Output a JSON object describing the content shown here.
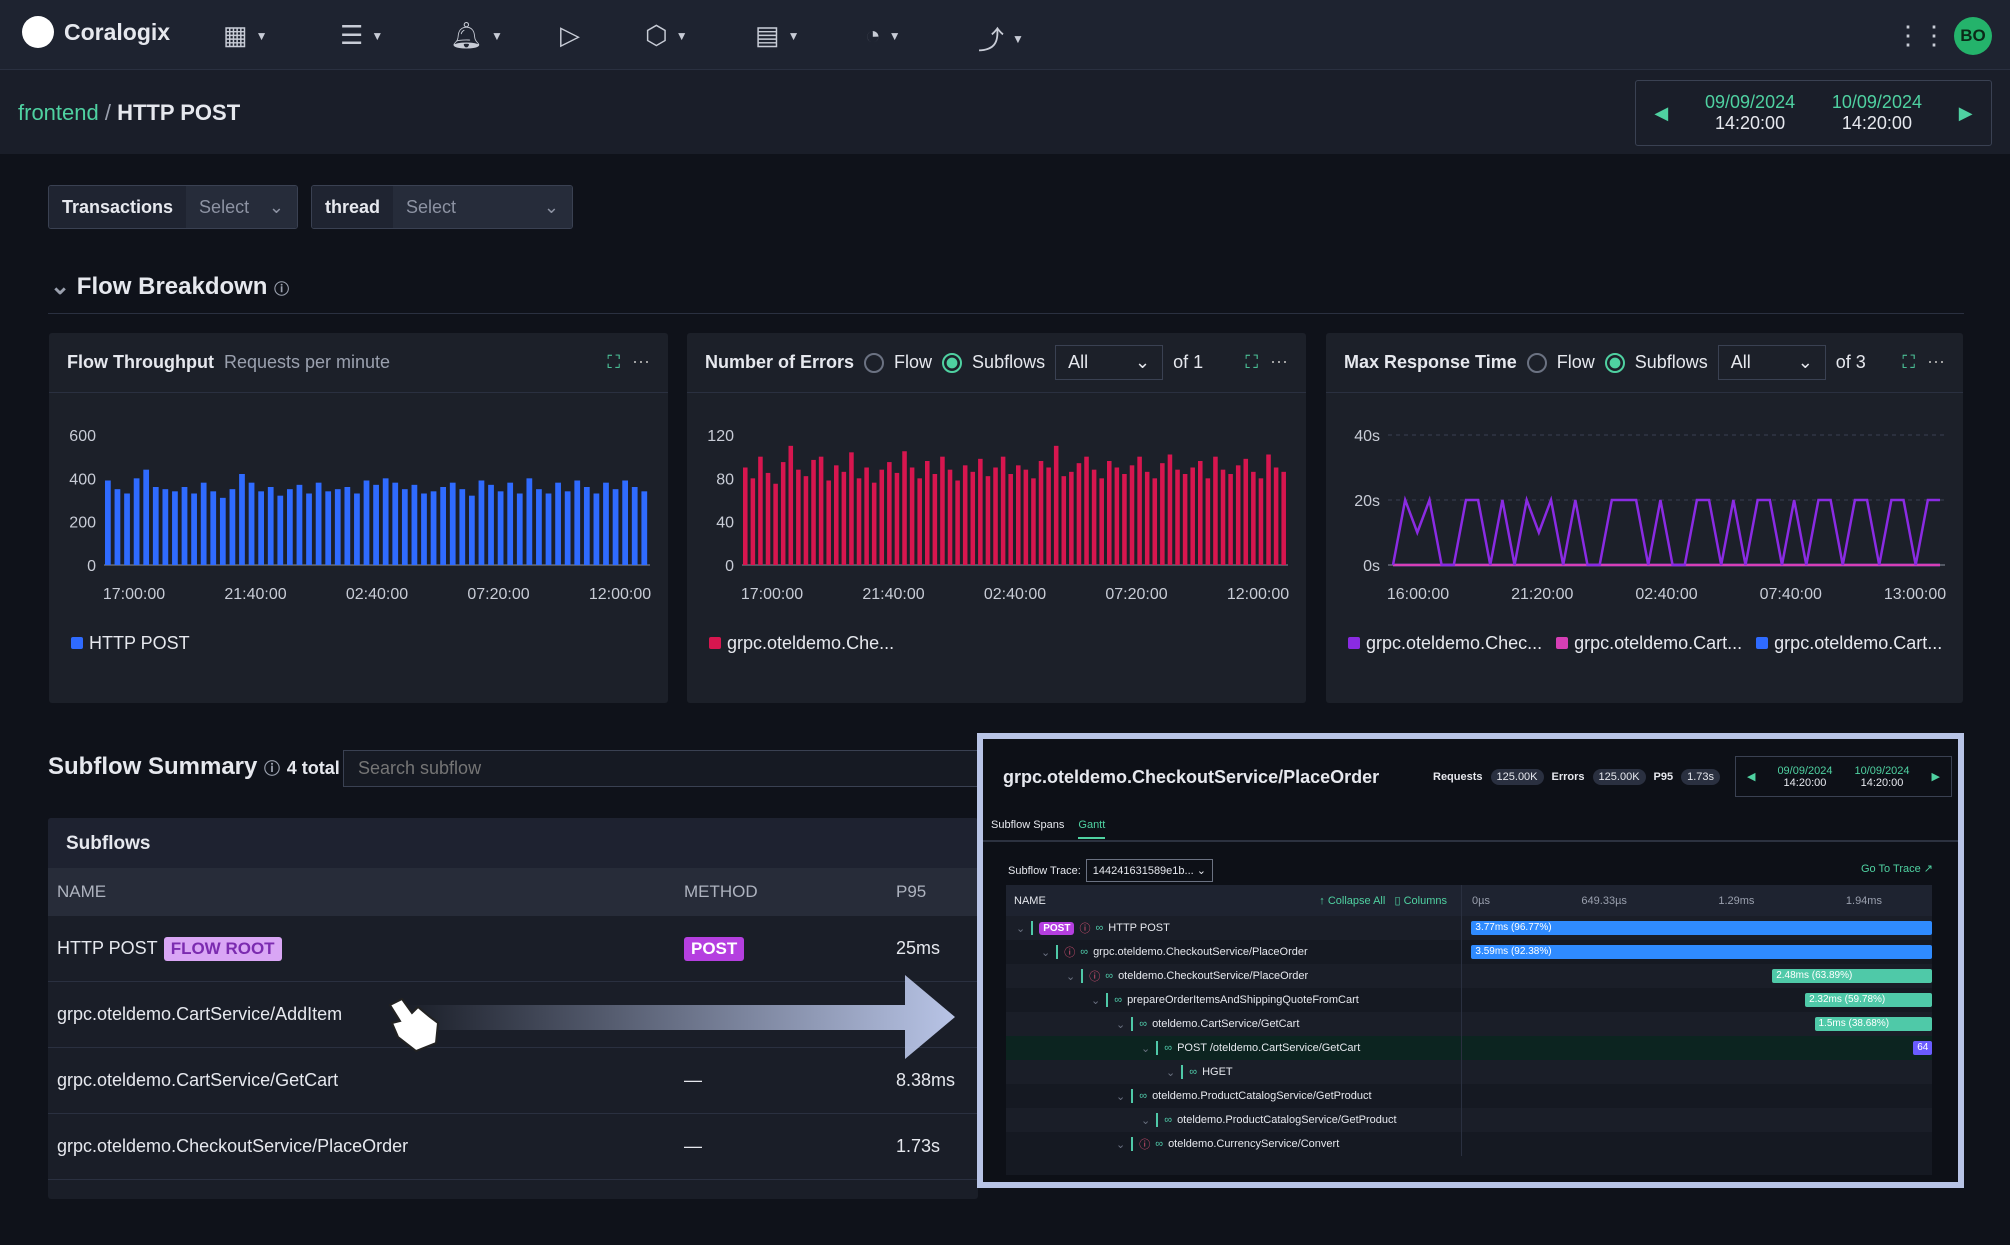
{
  "app": {
    "brand": "Coralogix",
    "user_initials": "BO",
    "nav_icons": [
      "dashboard-icon",
      "logs-icon",
      "bell-icon",
      "play-icon",
      "hexagon-icon",
      "server-icon",
      "gauge-icon",
      "flow-icon"
    ]
  },
  "breadcrumb": {
    "parent": "frontend",
    "current": "HTTP POST"
  },
  "daterange": {
    "from_date": "09/09/2024",
    "from_time": "14:20:00",
    "to_date": "10/09/2024",
    "to_time": "14:20:00"
  },
  "filters": [
    {
      "label": "Transactions",
      "value": "Select"
    },
    {
      "label": "thread",
      "value": "Select"
    }
  ],
  "flow_breakdown": {
    "title": "Flow Breakdown"
  },
  "panels": {
    "throughput": {
      "title": "Flow Throughput",
      "subtitle": "Requests per minute"
    },
    "errors": {
      "title": "Number of Errors",
      "radio_flow": "Flow",
      "radio_subflows": "Subflows",
      "select": "All",
      "of": "of 1"
    },
    "response": {
      "title": "Max Response Time",
      "radio_flow": "Flow",
      "radio_subflows": "Subflows",
      "select": "All",
      "of": "of 3"
    }
  },
  "chart_data": [
    {
      "type": "bar",
      "ylim": [
        0,
        600
      ],
      "yticks": [
        "600",
        "400",
        "200",
        "0"
      ],
      "xticks": [
        "17:00:00",
        "21:40:00",
        "02:40:00",
        "07:20:00",
        "12:00:00"
      ],
      "series": [
        {
          "name": "HTTP POST",
          "color": "#2f6bff",
          "values": [
            390,
            350,
            330,
            400,
            440,
            360,
            350,
            340,
            360,
            330,
            380,
            340,
            310,
            350,
            420,
            380,
            340,
            360,
            320,
            350,
            370,
            330,
            380,
            340,
            350,
            360,
            330,
            390,
            370,
            400,
            380,
            350,
            370,
            330,
            340,
            360,
            380,
            350,
            320,
            390,
            370,
            340,
            380,
            330,
            400,
            350,
            330,
            380,
            340,
            390,
            360,
            330,
            380,
            350,
            390,
            360,
            340
          ]
        }
      ]
    },
    {
      "type": "bar",
      "ylim": [
        0,
        120
      ],
      "yticks": [
        "120",
        "80",
        "40",
        "0"
      ],
      "xticks": [
        "17:00:00",
        "21:40:00",
        "02:40:00",
        "07:20:00",
        "12:00:00"
      ],
      "series": [
        {
          "name": "grpc.oteldemo.Che...",
          "color": "#d7164f",
          "values": [
            90,
            80,
            100,
            85,
            75,
            95,
            110,
            88,
            82,
            97,
            100,
            78,
            92,
            86,
            104,
            80,
            90,
            76,
            88,
            95,
            85,
            105,
            90,
            80,
            96,
            84,
            100,
            88,
            78,
            92,
            86,
            98,
            82,
            90,
            100,
            84,
            92,
            88,
            80,
            96,
            90,
            110,
            82,
            86,
            94,
            100,
            88,
            80,
            96,
            90,
            84,
            92,
            100,
            86,
            80,
            94,
            102,
            88,
            84,
            90,
            96,
            80,
            100,
            88,
            84,
            92,
            98,
            86,
            80,
            102,
            90,
            86
          ]
        }
      ]
    },
    {
      "type": "line",
      "ylim": [
        0,
        40
      ],
      "yticks": [
        "40s",
        "20s",
        "0s"
      ],
      "xticks": [
        "16:00:00",
        "21:20:00",
        "02:40:00",
        "07:40:00",
        "13:00:00"
      ],
      "series": [
        {
          "name": "grpc.oteldemo.Chec...",
          "color": "#8a2be2",
          "values": [
            0,
            20,
            10,
            20,
            0,
            0,
            20,
            20,
            0,
            20,
            0,
            20,
            10,
            20,
            0,
            20,
            0,
            0,
            20,
            20,
            20,
            0,
            20,
            0,
            0,
            20,
            20,
            0,
            20,
            0,
            20,
            20,
            0,
            20,
            0,
            20,
            20,
            0,
            20,
            20,
            0,
            20,
            20,
            0,
            20,
            20
          ]
        },
        {
          "name": "grpc.oteldemo.Cart...",
          "color": "#d63fb5",
          "values": [
            0,
            0,
            0,
            0,
            0,
            0,
            0,
            0,
            0,
            0,
            0,
            0,
            0,
            0,
            0,
            0,
            0,
            0,
            0,
            0,
            0,
            0,
            0,
            0,
            0,
            0,
            0,
            0,
            0,
            0,
            0,
            0,
            0,
            0,
            0,
            0,
            0,
            0,
            0,
            0,
            0,
            0,
            0,
            0,
            0,
            0
          ]
        },
        {
          "name": "grpc.oteldemo.Cart...",
          "color": "#2f6bff",
          "values": [
            0,
            0,
            0,
            0,
            0,
            0,
            0,
            0,
            0,
            0,
            0,
            0,
            0,
            0,
            0,
            0,
            0,
            0,
            0,
            0,
            0,
            0,
            0,
            0,
            0,
            0,
            0,
            0,
            0,
            0,
            0,
            0,
            0,
            0,
            0,
            0,
            0,
            0,
            0,
            0,
            0,
            0,
            0,
            0,
            0,
            0
          ]
        }
      ]
    }
  ],
  "subflow_summary": {
    "title": "Subflow Summary",
    "total": "4 total",
    "search_placeholder": "Search subflow",
    "table_title": "Subflows",
    "columns": [
      "NAME",
      "METHOD",
      "P95"
    ],
    "rows": [
      {
        "name": "HTTP POST",
        "badge": "FLOW ROOT",
        "method": "POST",
        "p95": "25ms"
      },
      {
        "name": "grpc.oteldemo.CartService/AddItem",
        "method": "",
        "p95": ""
      },
      {
        "name": "grpc.oteldemo.CartService/GetCart",
        "method": "—",
        "p95": "8.38ms"
      },
      {
        "name": "grpc.oteldemo.CheckoutService/PlaceOrder",
        "method": "—",
        "p95": "1.73s"
      }
    ]
  },
  "detail": {
    "title": "grpc.oteldemo.CheckoutService/PlaceOrder",
    "requests_label": "Requests",
    "requests": "125.00K",
    "errors_label": "Errors",
    "errors": "125.00K",
    "p95_label": "P95",
    "p95": "1.73s",
    "from_date": "09/09/2024",
    "from_time": "14:20:00",
    "to_date": "10/09/2024",
    "to_time": "14:20:00",
    "tabs": [
      "Subflow Spans",
      "Gantt"
    ],
    "trace_label": "Subflow Trace:",
    "trace_value": "144241631589e1b...",
    "go_to_trace": "Go To Trace",
    "gantt_header": {
      "name": "NAME",
      "collapse": "Collapse All",
      "columns": "Columns",
      "ticks": [
        "0µs",
        "649.33µs",
        "1.29ms",
        "1.94ms"
      ]
    },
    "spans": [
      {
        "name": "HTTP POST",
        "badge": "POST",
        "bar": "3.77ms (96.77%)"
      },
      {
        "name": "grpc.oteldemo.CheckoutService/PlaceOrder",
        "bar": "3.59ms (92.38%)"
      },
      {
        "name": "oteldemo.CheckoutService/PlaceOrder",
        "bar": "2.48ms (63.89%)"
      },
      {
        "name": "prepareOrderItemsAndShippingQuoteFromCart",
        "bar": "2.32ms (59.78%)"
      },
      {
        "name": "oteldemo.CartService/GetCart",
        "bar": "1.5ms (38.68%)"
      },
      {
        "name": "POST /oteldemo.CartService/GetCart",
        "bar": "64"
      },
      {
        "name": "HGET",
        "bar": ""
      },
      {
        "name": "oteldemo.ProductCatalogService/GetProduct",
        "bar": ""
      },
      {
        "name": "oteldemo.ProductCatalogService/GetProduct",
        "bar": ""
      },
      {
        "name": "oteldemo.CurrencyService/Convert",
        "bar": ""
      }
    ]
  }
}
